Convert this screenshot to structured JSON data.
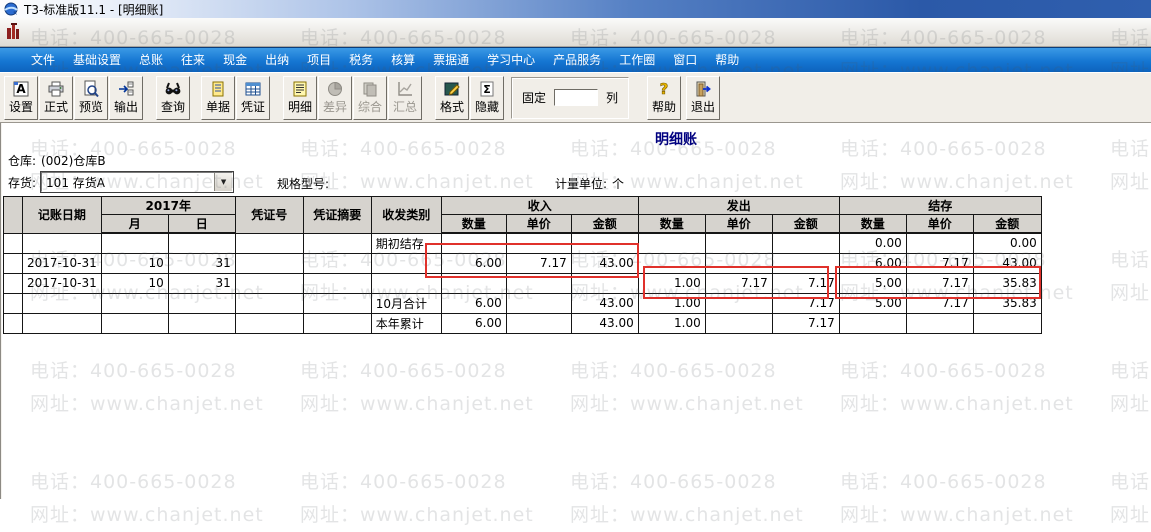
{
  "window": {
    "title": "T3-标准版11.1 - [明细账]"
  },
  "menu": {
    "items": [
      "文件",
      "基础设置",
      "总账",
      "往来",
      "现金",
      "出纳",
      "项目",
      "税务",
      "核算",
      "票据通",
      "学习中心",
      "产品服务",
      "工作圈",
      "窗口",
      "帮助"
    ]
  },
  "toolbar": {
    "buttons": [
      {
        "label": "设置",
        "icon": "settings-icon",
        "enabled": true
      },
      {
        "label": "正式",
        "icon": "print-icon",
        "enabled": true
      },
      {
        "label": "预览",
        "icon": "preview-icon",
        "enabled": true
      },
      {
        "label": "输出",
        "icon": "export-icon",
        "enabled": true
      },
      {
        "label": "查询",
        "icon": "search-icon",
        "enabled": true
      },
      {
        "label": "单据",
        "icon": "document-icon",
        "enabled": true
      },
      {
        "label": "凭证",
        "icon": "voucher-grid-icon",
        "enabled": true
      },
      {
        "label": "明细",
        "icon": "detail-icon",
        "enabled": true
      },
      {
        "label": "差异",
        "icon": "pie-icon",
        "enabled": false
      },
      {
        "label": "综合",
        "icon": "composite-icon",
        "enabled": false
      },
      {
        "label": "汇总",
        "icon": "summary-chart-icon",
        "enabled": false
      },
      {
        "label": "格式",
        "icon": "format-icon",
        "enabled": true
      },
      {
        "label": "隐藏",
        "icon": "sigma-icon",
        "enabled": true
      },
      {
        "label": "帮助",
        "icon": "help-icon",
        "enabled": true
      },
      {
        "label": "退出",
        "icon": "exit-icon",
        "enabled": true
      }
    ],
    "fixed_columns": {
      "prefix": "固定",
      "suffix": "列",
      "value": ""
    }
  },
  "report": {
    "title": "明细账",
    "warehouse_label": "仓库:",
    "warehouse_value": "(002)仓库B",
    "stock_label": "存货:",
    "stock_value": "101 存货A",
    "spec_label": "规格型号:",
    "spec_value": "",
    "unit_label": "计量单位:",
    "unit_value": "个"
  },
  "table": {
    "headers": {
      "date": "记账日期",
      "year": "2017年",
      "month": "月",
      "day": "日",
      "voucher_no": "凭证号",
      "voucher_summary": "凭证摘要",
      "category": "收发类别",
      "in": "收入",
      "out": "发出",
      "balance": "结存",
      "qty": "数量",
      "price": "单价",
      "amount": "金额"
    },
    "rows": [
      [
        "",
        "",
        "",
        "",
        "",
        "",
        "期初结存",
        "",
        "",
        "",
        "",
        "",
        "",
        "0.00",
        "",
        "0.00"
      ],
      [
        "",
        "2017-10-31",
        "10",
        "31",
        "",
        "",
        "",
        "6.00",
        "7.17",
        "43.00",
        "",
        "",
        "",
        "6.00",
        "7.17",
        "43.00"
      ],
      [
        "",
        "2017-10-31",
        "10",
        "31",
        "",
        "",
        "",
        "",
        "",
        "",
        "1.00",
        "7.17",
        "7.17",
        "5.00",
        "7.17",
        "35.83"
      ],
      [
        "",
        "",
        "",
        "",
        "",
        "",
        "10月合计",
        "6.00",
        "",
        "43.00",
        "1.00",
        "",
        "7.17",
        "5.00",
        "7.17",
        "35.83"
      ],
      [
        "",
        "",
        "",
        "",
        "",
        "",
        "本年累计",
        "6.00",
        "",
        "43.00",
        "1.00",
        "",
        "7.17",
        "",
        "",
        ""
      ]
    ]
  },
  "watermark": {
    "phone": "电话：400-665-0028",
    "site": "网址：www.chanjet.net"
  },
  "colors": {
    "menu_blue": "#1576d2",
    "highlight_red": "#e0312b",
    "title_navy": "#000080"
  }
}
